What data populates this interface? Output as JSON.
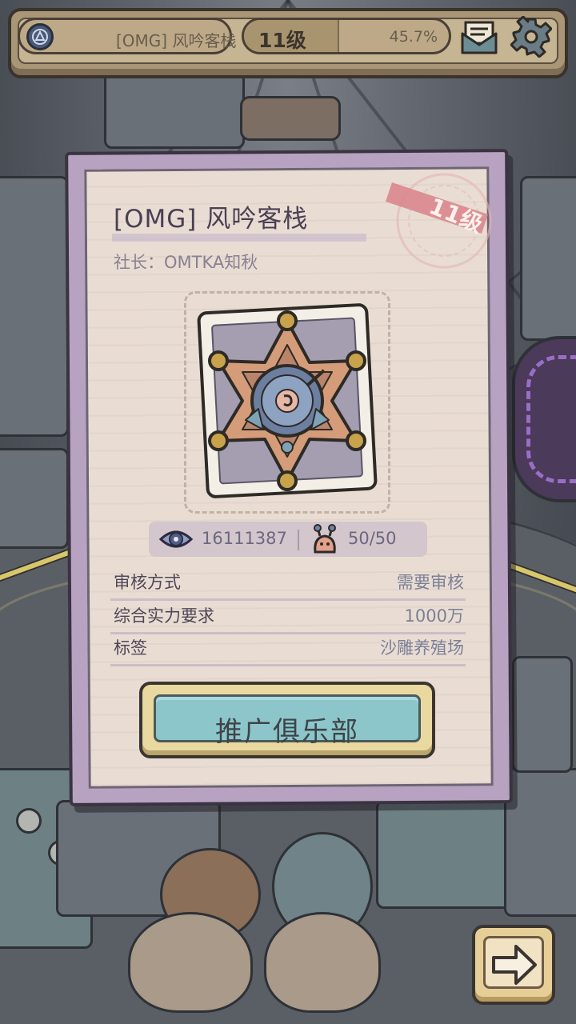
{
  "topbar": {
    "club_name": "[OMG] 风吟客栈",
    "level": "11级",
    "progress": "45.7%",
    "progress_fraction": 0.457,
    "icons": [
      "club-badge-icon",
      "mail-icon",
      "gear-icon"
    ]
  },
  "card": {
    "stamp_level": "11级",
    "title": "[OMG] 风吟客栈",
    "leader": "社长：OMTKA知秋",
    "views": "16111387",
    "members": "50/50",
    "rows": [
      {
        "key": "审核方式",
        "value": "需要审核"
      },
      {
        "key": "综合实力要求",
        "value": "1000万"
      },
      {
        "key": "标签",
        "value": "沙雕养殖场"
      }
    ],
    "promote_label": "推广俱乐部"
  },
  "colors": {
    "card_frame": "#b7a2c1",
    "card_paper": "#e9dcd3",
    "button_teal": "#8cc6cb",
    "stamp_red": "#d9828a"
  },
  "nav": {
    "next_icon": "arrow-right-icon"
  }
}
